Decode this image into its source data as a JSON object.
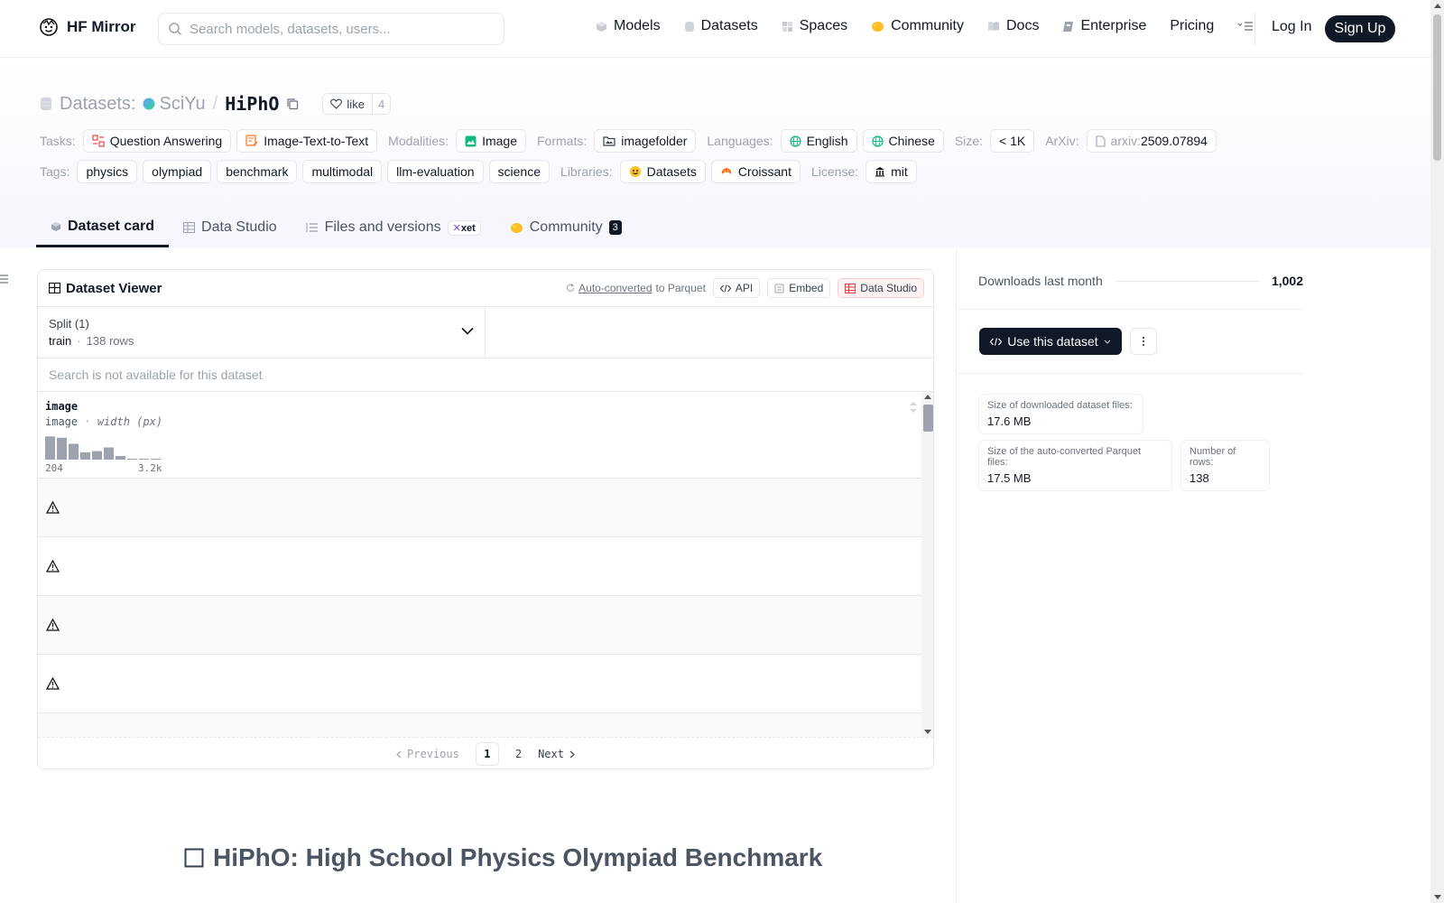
{
  "header": {
    "brand": "HF Mirror",
    "search_placeholder": "Search models, datasets, users...",
    "nav": [
      "Models",
      "Datasets",
      "Spaces",
      "Community",
      "Docs",
      "Enterprise",
      "Pricing"
    ],
    "login": "Log In",
    "signup": "Sign Up"
  },
  "repo": {
    "section_label": "Datasets:",
    "owner": "SciYu",
    "name": "HiPhO",
    "like_label": "like",
    "like_count": "4"
  },
  "meta": {
    "tasks_label": "Tasks:",
    "tasks": [
      "Question Answering",
      "Image-Text-to-Text"
    ],
    "modalities_label": "Modalities:",
    "modalities": [
      "Image"
    ],
    "formats_label": "Formats:",
    "formats": [
      "imagefolder"
    ],
    "languages_label": "Languages:",
    "languages": [
      "English",
      "Chinese"
    ],
    "size_label": "Size:",
    "size": "< 1K",
    "arxiv_label": "ArXiv:",
    "arxiv_prefix": "arxiv:",
    "arxiv_id": "2509.07894",
    "tags_label": "Tags:",
    "tags": [
      "physics",
      "olympiad",
      "benchmark",
      "multimodal",
      "llm-evaluation",
      "science"
    ],
    "libraries_label": "Libraries:",
    "libraries": [
      "Datasets",
      "Croissant"
    ],
    "license_label": "License:",
    "license": "mit"
  },
  "tabs": {
    "dataset_card": "Dataset card",
    "data_studio": "Data Studio",
    "files": "Files and versions",
    "xet": "xet",
    "community": "Community",
    "community_count": "3"
  },
  "viewer": {
    "title": "Dataset Viewer",
    "auto_converted": "Auto-converted",
    "to_parquet": "to Parquet",
    "api": "API",
    "embed": "Embed",
    "data_studio": "Data Studio",
    "split_label": "Split (1)",
    "split_name": "train",
    "split_rows": "138 rows",
    "search_disabled": "Search is not available for this dataset",
    "column_name": "image",
    "column_type": "image",
    "column_stat": "width (px)",
    "hist_min": "204",
    "hist_max": "3.2k",
    "hist_values": [
      0.95,
      0.9,
      0.65,
      0.3,
      0.35,
      0.5,
      0.15,
      0.04,
      0,
      0.02
    ],
    "pager_prev": "Previous",
    "pager_page1": "1",
    "pager_page2": "2",
    "pager_next": "Next"
  },
  "sidebar": {
    "downloads_label": "Downloads last month",
    "downloads_value": "1,002",
    "use_dataset": "Use this dataset",
    "size_downloaded_label": "Size of downloaded dataset files:",
    "size_downloaded_value": "17.6 MB",
    "size_parquet_label": "Size of the auto-converted Parquet files:",
    "size_parquet_value": "17.5 MB",
    "num_rows_label": "Number of rows:",
    "num_rows_value": "138"
  },
  "card": {
    "heading": "HiPhO: High School Physics Olympiad Benchmark"
  }
}
